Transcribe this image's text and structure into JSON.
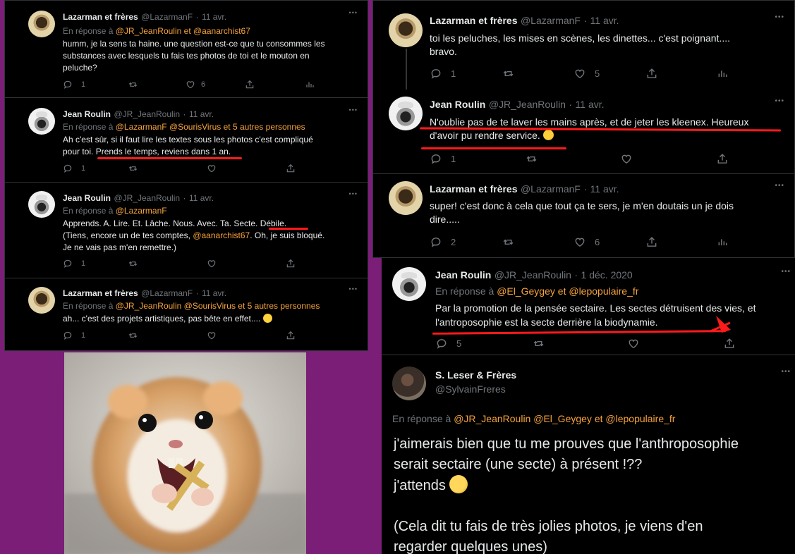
{
  "panel_a": {
    "tweets": [
      {
        "name": "Lazarman et frères",
        "handle": "@LazarmanF",
        "date": "11 avr.",
        "reply_prefix": "En réponse à",
        "mentions": [
          "@JR_JeanRoulin",
          "et",
          "@aanarchist67"
        ],
        "lines": [
          "humm, je la sens ta haine. une question est-ce que tu consommes les",
          "substances avec lesquels tu fais tes photos de toi et le mouton en",
          "peluche?"
        ],
        "replies": "1",
        "retweets": "",
        "likes": "6"
      },
      {
        "name": "Jean Roulin",
        "handle": "@JR_JeanRoulin",
        "date": "11 avr.",
        "reply_prefix": "En réponse à",
        "mentions": [
          "@LazarmanF @SourisVirus",
          "et 5 autres personnes"
        ],
        "lines": [
          "Ah c'est sûr, si il faut lire les textes sous les photos c'est compliqué",
          "pour toi. Prends le temps, reviens dans 1 an."
        ],
        "replies": "1",
        "retweets": "",
        "likes": ""
      },
      {
        "name": "Jean Roulin",
        "handle": "@JR_JeanRoulin",
        "date": "11 avr.",
        "reply_prefix": "En réponse à",
        "mentions": [
          "@LazarmanF"
        ],
        "lines": [
          "Apprends. A. Lire. Et. Lâche. Nous. Avec. Ta. Secte. Débile.",
          "(Tiens, encore un de tes comptes, ",
          "@aanarchist67",
          ". Oh, je suis bloqué.",
          "Je ne vais pas m'en remettre.)"
        ],
        "replies": "1",
        "retweets": "",
        "likes": ""
      },
      {
        "name": "Lazarman et frères",
        "handle": "@LazarmanF",
        "date": "11 avr.",
        "reply_prefix": "En réponse à",
        "mentions": [
          "@JR_JeanRoulin @SourisVirus",
          "et 5 autres personnes"
        ],
        "lines": [
          "ah... c'est des projets artistiques, pas bête en effet...."
        ],
        "replies": "1",
        "retweets": "",
        "likes": ""
      }
    ]
  },
  "panel_b": {
    "tweets": [
      {
        "name": "Lazarman et frères",
        "handle": "@LazarmanF",
        "date": "11 avr.",
        "lines": [
          "toi les peluches, les mises en scènes, les dinettes... c'est poignant....",
          "bravo."
        ],
        "replies": "1",
        "retweets": "",
        "likes": "5"
      },
      {
        "name": "Jean Roulin",
        "handle": "@JR_JeanRoulin",
        "date": "11 avr.",
        "lines": [
          "N'oublie pas de te laver les mains après, et de jeter les kleenex. Heureux",
          "d'avoir pu rendre service."
        ],
        "replies": "1",
        "retweets": "",
        "likes": ""
      },
      {
        "name": "Lazarman et frères",
        "handle": "@LazarmanF",
        "date": "11 avr.",
        "lines": [
          "super!  c'est donc à cela que tout ça te sers, je m'en doutais un je dois",
          "dire....."
        ],
        "replies": "2",
        "retweets": "",
        "likes": "6"
      }
    ]
  },
  "panel_c": {
    "tweet": {
      "name": "Jean Roulin",
      "handle": "@JR_JeanRoulin",
      "date": "1 déc. 2020",
      "reply_prefix": "En réponse à",
      "mentions": [
        "@El_Geygey",
        "et",
        "@lepopulaire_fr"
      ],
      "lines": [
        "Par la promotion de la pensée sectaire. Les sectes détruisent des vies, et",
        "l'antroposophie est la secte derrière la biodynamie."
      ],
      "replies": "5",
      "retweets": "",
      "likes": ""
    },
    "main": {
      "name": "S. Leser & Frères",
      "handle": "@SylvainFreres",
      "reply_prefix": "En réponse à",
      "mentions": [
        "@JR_JeanRoulin @El_Geygey",
        "et",
        "@lepopulaire_fr"
      ],
      "lines": [
        "j'aimerais bien que tu me prouves que l'anthroposophie",
        "serait sectaire (une secte) à présent !??",
        "j'attends",
        "",
        "(Cela dit tu fais de très jolies photos, je viens d'en",
        "regarder quelques unes)"
      ]
    }
  },
  "dot": "·",
  "more": "•••",
  "colors": {
    "background": "#7a1e78",
    "panel": "#000000",
    "mention": "#f7a33b",
    "annotation": "#ff1a1a",
    "muted": "#71767b"
  }
}
